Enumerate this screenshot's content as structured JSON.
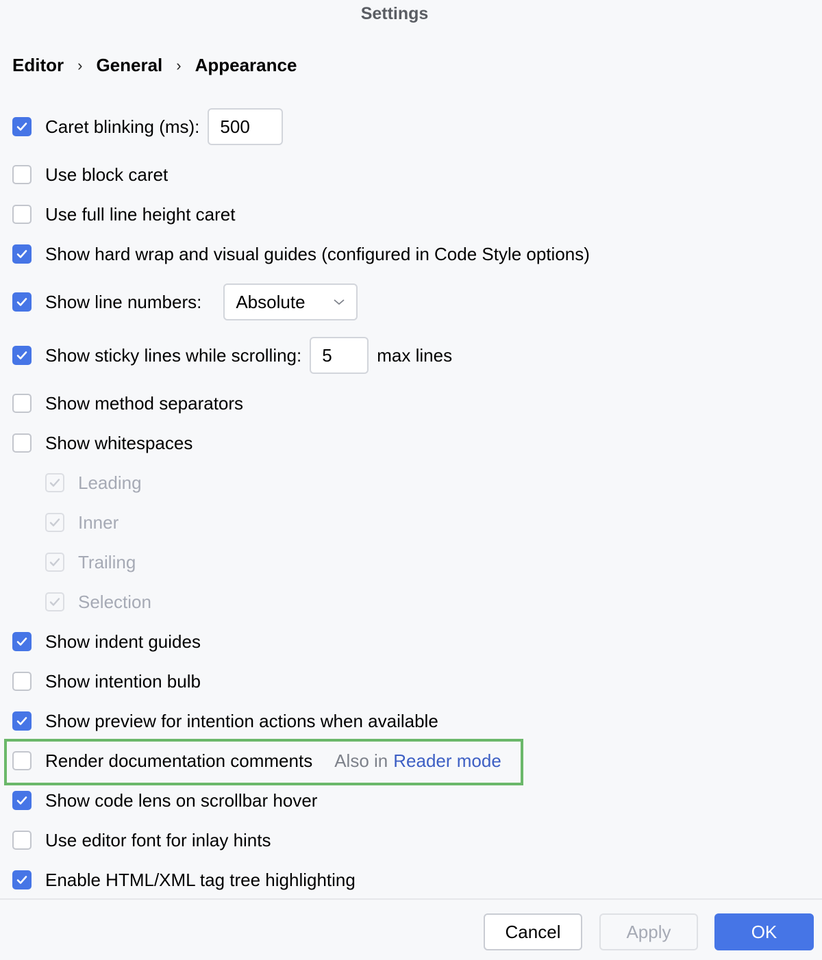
{
  "window": {
    "title": "Settings"
  },
  "breadcrumb": [
    "Editor",
    "General",
    "Appearance"
  ],
  "options": {
    "caret_blinking": {
      "label": "Caret blinking (ms):",
      "checked": true,
      "value": "500"
    },
    "block_caret": {
      "label": "Use block caret",
      "checked": false
    },
    "full_line_caret": {
      "label": "Use full line height caret",
      "checked": false
    },
    "hard_wrap": {
      "label": "Show hard wrap and visual guides (configured in Code Style options)",
      "checked": true
    },
    "line_numbers": {
      "label": "Show line numbers:",
      "checked": true,
      "selected": "Absolute"
    },
    "sticky_lines": {
      "label": "Show sticky lines while scrolling:",
      "checked": true,
      "value": "5",
      "suffix": "max lines"
    },
    "method_separators": {
      "label": "Show method separators",
      "checked": false
    },
    "whitespaces": {
      "label": "Show whitespaces",
      "checked": false
    },
    "ws_leading": {
      "label": "Leading",
      "checked": true,
      "disabled": true
    },
    "ws_inner": {
      "label": "Inner",
      "checked": true,
      "disabled": true
    },
    "ws_trailing": {
      "label": "Trailing",
      "checked": true,
      "disabled": true
    },
    "ws_selection": {
      "label": "Selection",
      "checked": true,
      "disabled": true
    },
    "indent_guides": {
      "label": "Show indent guides",
      "checked": true
    },
    "intention_bulb": {
      "label": "Show intention bulb",
      "checked": false
    },
    "intention_preview": {
      "label": "Show preview for intention actions when available",
      "checked": true
    },
    "render_docs": {
      "label": "Render documentation comments",
      "checked": false,
      "hint": "Also in",
      "link": "Reader mode"
    },
    "code_lens": {
      "label": "Show code lens on scrollbar hover",
      "checked": true
    },
    "editor_font_hints": {
      "label": "Use editor font for inlay hints",
      "checked": false
    },
    "tag_tree": {
      "label": "Enable HTML/XML tag tree highlighting",
      "checked": true
    }
  },
  "footer": {
    "cancel": "Cancel",
    "apply": "Apply",
    "ok": "OK"
  },
  "colors": {
    "accent": "#4675e6",
    "highlight": "#6bb86a",
    "link": "#3d5fc4"
  }
}
